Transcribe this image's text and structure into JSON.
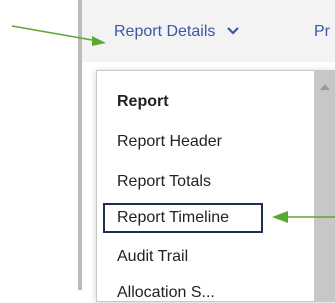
{
  "nav": {
    "report_details_label": "Report Details",
    "next_label": "Pr"
  },
  "dropdown": {
    "items": [
      {
        "label": "Report"
      },
      {
        "label": "Report Header"
      },
      {
        "label": "Report Totals"
      },
      {
        "label": "Report Timeline"
      },
      {
        "label": "Audit Trail"
      },
      {
        "label": "Allocation S..."
      }
    ]
  },
  "colors": {
    "nav_text": "#3b57a8",
    "annotation_arrow": "#5aa832",
    "highlight_border": "#1f2f4f"
  }
}
